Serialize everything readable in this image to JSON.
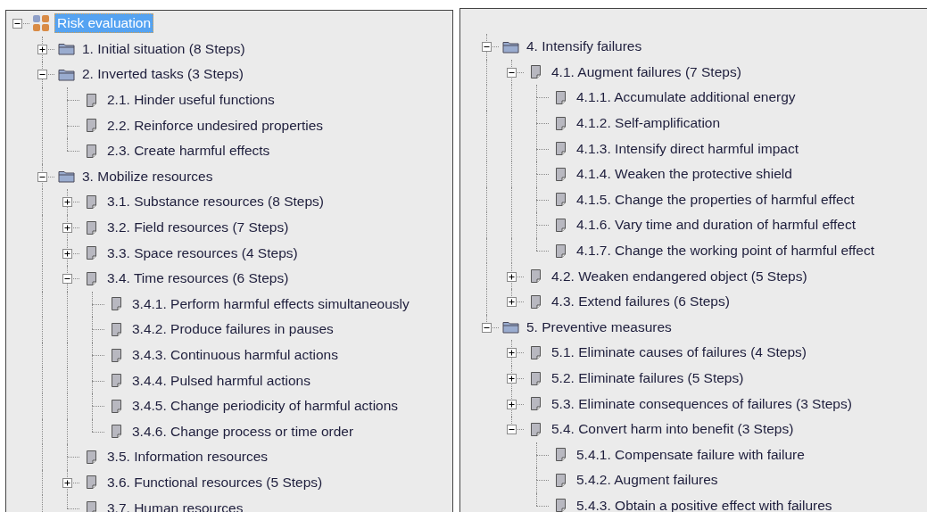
{
  "left_panel": {
    "tree": [
      {
        "label": "Risk evaluation",
        "kind": "root",
        "expanded": true,
        "selected": true,
        "more_below": true,
        "children": [
          {
            "label": "1. Initial situation (8 Steps)",
            "kind": "folder",
            "expanded": false,
            "selected": false
          },
          {
            "label": "2. Inverted tasks (3 Steps)",
            "kind": "folder",
            "expanded": true,
            "selected": false,
            "children": [
              {
                "label": "2.1. Hinder useful functions",
                "kind": "page",
                "selected": false
              },
              {
                "label": "2.2. Reinforce undesired properties",
                "kind": "page",
                "selected": false
              },
              {
                "label": "2.3. Create harmful effects",
                "kind": "page",
                "selected": false
              }
            ]
          },
          {
            "label": "3. Mobilize resources",
            "kind": "folder",
            "expanded": true,
            "selected": false,
            "children": [
              {
                "label": "3.1. Substance resources (8 Steps)",
                "kind": "page",
                "expanded": false,
                "selected": false
              },
              {
                "label": "3.2. Field resources (7 Steps)",
                "kind": "page",
                "expanded": false,
                "selected": false
              },
              {
                "label": "3.3. Space resources (4 Steps)",
                "kind": "page",
                "expanded": false,
                "selected": false
              },
              {
                "label": "3.4. Time resources (6 Steps)",
                "kind": "page",
                "expanded": true,
                "selected": false,
                "children": [
                  {
                    "label": "3.4.1. Perform harmful effects simultaneously",
                    "kind": "page",
                    "selected": false
                  },
                  {
                    "label": "3.4.2. Produce failures in pauses",
                    "kind": "page",
                    "selected": false
                  },
                  {
                    "label": "3.4.3. Continuous harmful actions",
                    "kind": "page",
                    "selected": false
                  },
                  {
                    "label": "3.4.4. Pulsed harmful actions",
                    "kind": "page",
                    "selected": false
                  },
                  {
                    "label": "3.4.5. Change periodicity of harmful actions",
                    "kind": "page",
                    "selected": false
                  },
                  {
                    "label": "3.4.6. Change process or time order",
                    "kind": "page",
                    "selected": false
                  }
                ]
              },
              {
                "label": "3.5. Information resources",
                "kind": "page",
                "selected": false
              },
              {
                "label": "3.6. Functional resources (5 Steps)",
                "kind": "page",
                "expanded": false,
                "selected": false
              },
              {
                "label": "3.7. Human resources",
                "kind": "page",
                "selected": false
              }
            ]
          }
        ]
      }
    ]
  },
  "right_panel": {
    "more_above": true,
    "tree": [
      {
        "label": "4. Intensify failures",
        "kind": "folder",
        "expanded": true,
        "selected": false,
        "children": [
          {
            "label": "4.1. Augment failures (7 Steps)",
            "kind": "page",
            "expanded": true,
            "selected": false,
            "children": [
              {
                "label": "4.1.1. Accumulate additional energy",
                "kind": "page",
                "selected": false
              },
              {
                "label": "4.1.2. Self-amplification",
                "kind": "page",
                "selected": false
              },
              {
                "label": "4.1.3. Intensify direct harmful impact",
                "kind": "page",
                "selected": false
              },
              {
                "label": "4.1.4. Weaken the protective shield",
                "kind": "page",
                "selected": false
              },
              {
                "label": "4.1.5. Change the properties of harmful effect",
                "kind": "page",
                "selected": false
              },
              {
                "label": "4.1.6. Vary time and duration of harmful effect",
                "kind": "page",
                "selected": false
              },
              {
                "label": "4.1.7. Change the working point of harmful effect",
                "kind": "page",
                "selected": false
              }
            ]
          },
          {
            "label": "4.2. Weaken endangered object (5 Steps)",
            "kind": "page",
            "expanded": false,
            "selected": false
          },
          {
            "label": "4.3. Extend failures (6 Steps)",
            "kind": "page",
            "expanded": false,
            "selected": false
          }
        ]
      },
      {
        "label": "5. Preventive measures",
        "kind": "folder",
        "expanded": true,
        "selected": false,
        "children": [
          {
            "label": "5.1. Eliminate causes of failures (4 Steps)",
            "kind": "page",
            "expanded": false,
            "selected": false
          },
          {
            "label": "5.2. Eliminate failures (5 Steps)",
            "kind": "page",
            "expanded": false,
            "selected": false
          },
          {
            "label": "5.3. Eliminate consequences of failures (3 Steps)",
            "kind": "page",
            "expanded": false,
            "selected": false
          },
          {
            "label": "5.4. Convert harm into benefit (3 Steps)",
            "kind": "page",
            "expanded": true,
            "selected": false,
            "children": [
              {
                "label": "5.4.1. Compensate failure with failure",
                "kind": "page",
                "selected": false
              },
              {
                "label": "5.4.2. Augment failures",
                "kind": "page",
                "selected": false
              },
              {
                "label": "5.4.3. Obtain a positive effect with failures",
                "kind": "page",
                "selected": false
              }
            ]
          }
        ]
      }
    ]
  }
}
